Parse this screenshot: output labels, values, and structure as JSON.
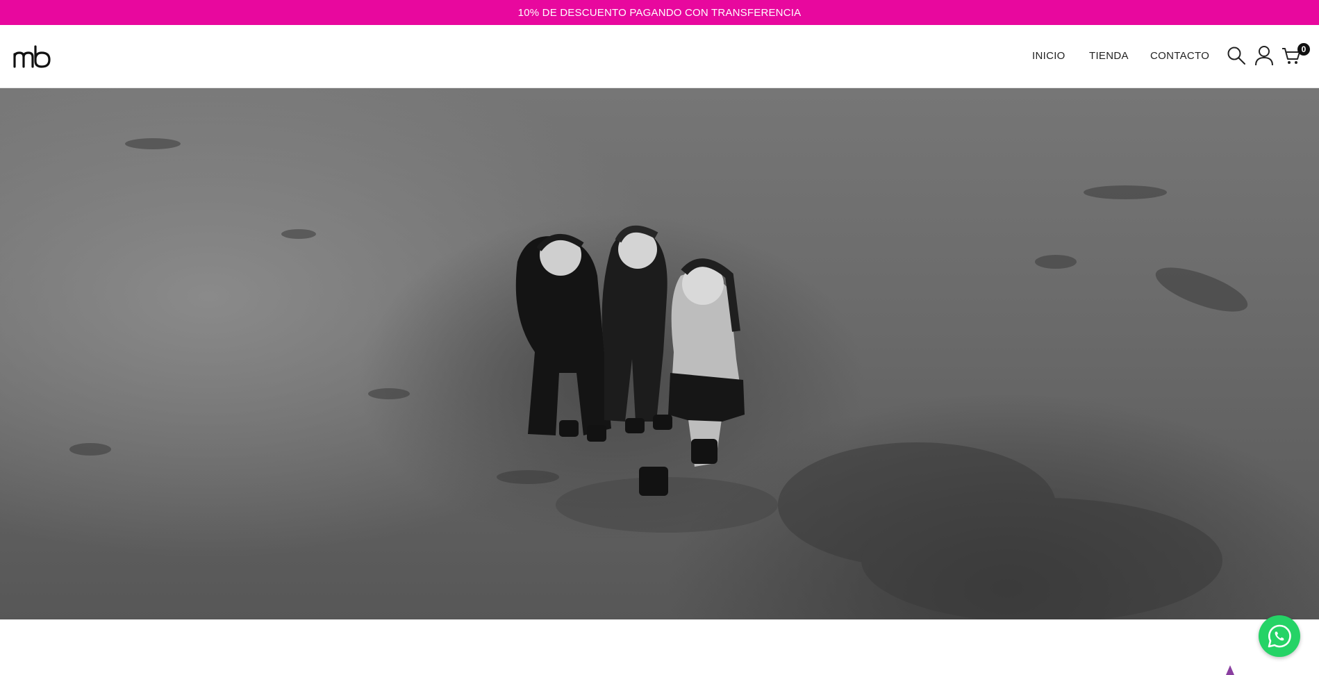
{
  "announcement": {
    "text": "10% DE DESCUENTO PAGANDO CON TRANSFERENCIA",
    "background": "#e8089e"
  },
  "header": {
    "logo_icon": "mb-logo",
    "nav": [
      {
        "label": "INICIO"
      },
      {
        "label": "TIENDA"
      },
      {
        "label": "CONTACTO"
      }
    ],
    "icons": [
      "search-icon",
      "user-icon",
      "cart-icon"
    ],
    "cart_count": "0"
  },
  "hero": {
    "image": "black-and-white aerial photo of three women on dirt ground"
  },
  "floating": {
    "icon": "whatsapp-icon",
    "color": "#25d366"
  }
}
